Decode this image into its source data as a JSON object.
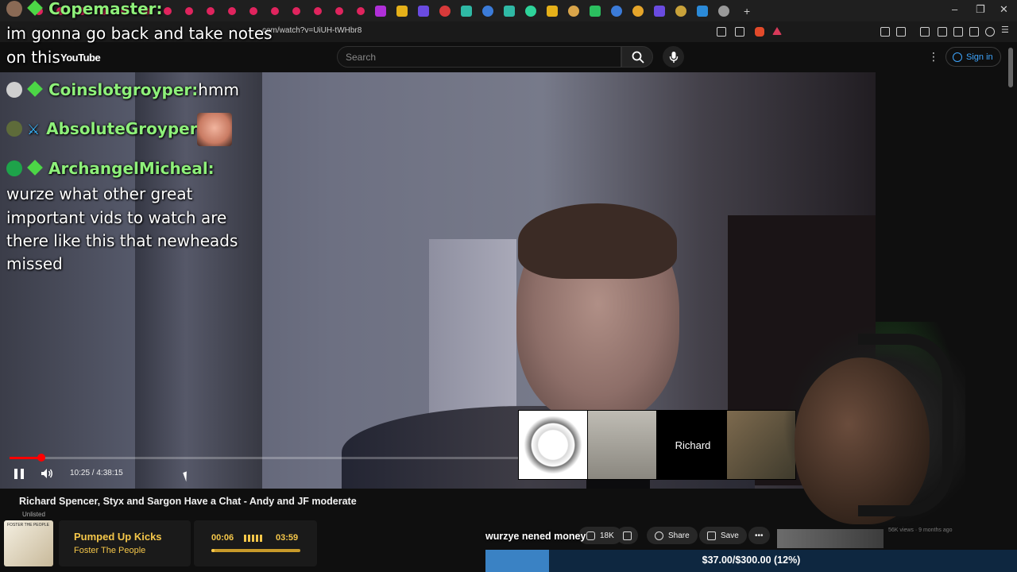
{
  "browser": {
    "url": "com/watch?v=UiUH-tWHbr8",
    "window_controls": [
      "–",
      "❐",
      "✕"
    ],
    "new_tab": "+"
  },
  "youtube": {
    "logo": "YouTube",
    "search_placeholder": "Search",
    "sign_in": "Sign in"
  },
  "chat": {
    "messages": [
      {
        "user": "Copemaster:",
        "text": "im gonna go back and take notes on this",
        "text_line1": "im gonna go back and take notes",
        "text_line2": "on this"
      },
      {
        "user": "Coinslotgroyper:",
        "text": "hmm"
      },
      {
        "user": "AbsoluteGroyper:",
        "text": ""
      },
      {
        "user": "ArchangelMicheal:",
        "text": "wurze what other great important vids to watch are there like this that newheads missed",
        "lines": [
          "wurze what other great",
          "important vids to watch are",
          "there like this that newheads",
          "missed"
        ]
      }
    ]
  },
  "player": {
    "time": "10:25 / 4:38:15",
    "progress": 0.037
  },
  "overlay_card": {
    "name": "Richard"
  },
  "video": {
    "title": "Richard Spencer, Styx and Sargon Have a Chat - Andy and JF moderate",
    "visibility": "Unlisted",
    "likes": "18K",
    "share": "Share",
    "save": "Save",
    "more": "•••",
    "side_meta": "56K views · 9 months ago"
  },
  "music": {
    "album_caption": "FOSTER THE PEOPLE",
    "song": "Pumped Up Kicks",
    "artist": "Foster The People",
    "elapsed": "00:06",
    "duration": "03:59",
    "progress": 0.025
  },
  "donation": {
    "alert": "wurzye nened money",
    "goal_text": "$37.00/$300.00 (12%)",
    "goal_fraction": 0.12
  },
  "colors": {
    "chat_name": "#8ef07a",
    "music_accent": "#f5c74a",
    "progress": "#ff0000",
    "goal_fill": "#3a82c4"
  }
}
